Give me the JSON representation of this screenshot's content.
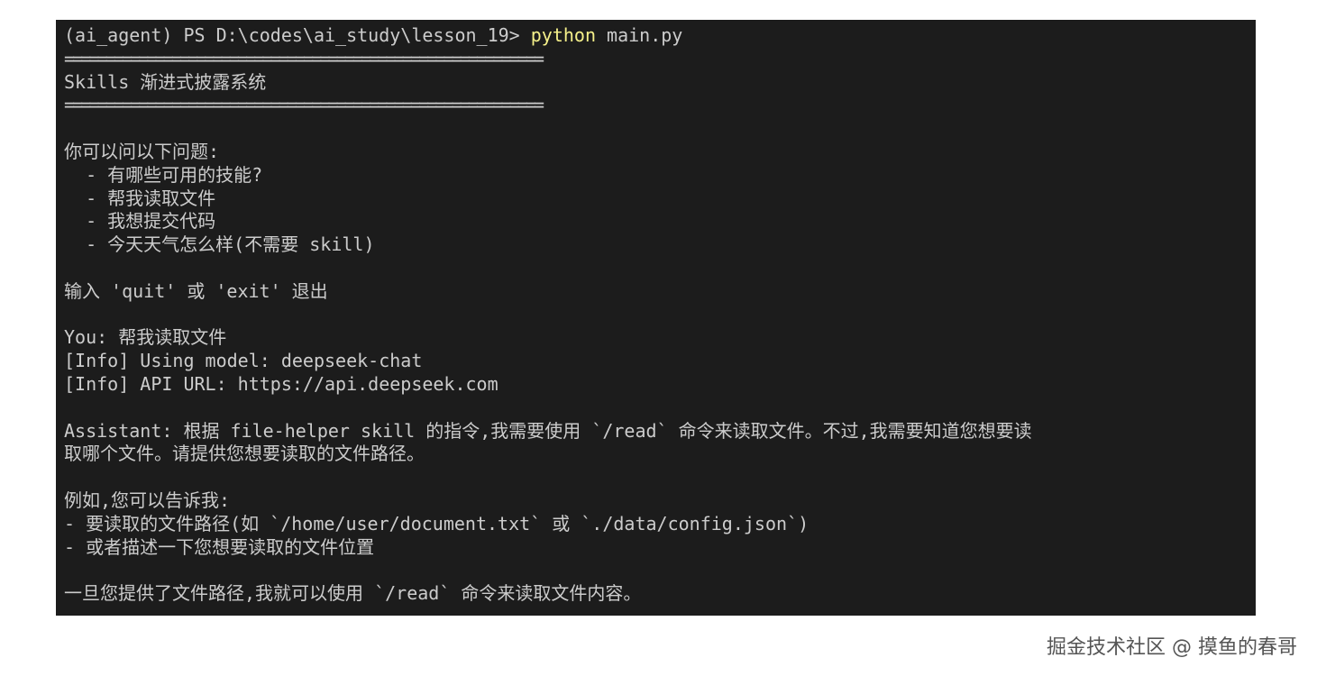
{
  "terminal": {
    "prompt": {
      "prefix": "(ai_agent) PS D:\\codes\\ai_study\\lesson_19> ",
      "command": "python",
      "args": " main.py"
    },
    "rule": "==========================================================",
    "banner_title": "Skills 渐进式披露系统",
    "intro": "你可以问以下问题:",
    "examples": [
      "  - 有哪些可用的技能?",
      "  - 帮我读取文件",
      "  - 我想提交代码",
      "  - 今天天气怎么样(不需要 skill)"
    ],
    "exit_hint": "输入 'quit' 或 'exit' 退出",
    "user_input": "You: 帮我读取文件",
    "info_model": "[Info] Using model: deepseek-chat",
    "info_api": "[Info] API URL: https://api.deepseek.com",
    "assistant_line1": "Assistant: 根据 file-helper skill 的指令,我需要使用 `/read` 命令来读取文件。不过,我需要知道您想要读",
    "assistant_line2": "取哪个文件。请提供您想要读取的文件路径。",
    "example_intro": "例如,您可以告诉我:",
    "option1": "- 要读取的文件路径(如 `/home/user/document.txt` 或 `./data/config.json`)",
    "option2": "- 或者描述一下您想要读取的文件位置",
    "closing": "一旦您提供了文件路径,我就可以使用 `/read` 命令来读取文件内容。"
  },
  "watermark": "掘金技术社区 @ 摸鱼的春哥",
  "colors": {
    "terminal_bg": "#1c1c1c",
    "terminal_text": "#cccccc",
    "command_highlight": "#f5f08a"
  }
}
